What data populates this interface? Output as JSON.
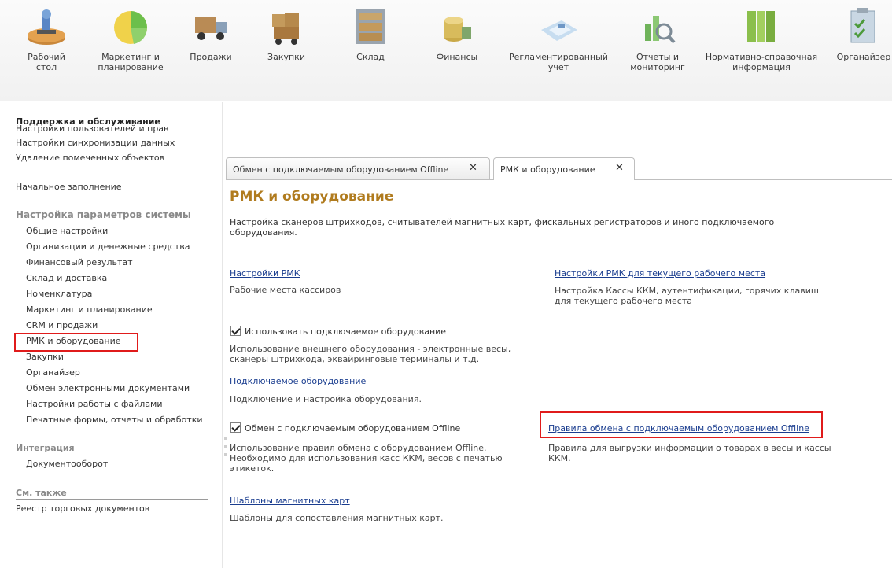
{
  "sections": [
    {
      "label": "Рабочий\nстол",
      "icon": "desktop-icon"
    },
    {
      "label": "Маркетинг и\nпланирование",
      "icon": "pie-chart-icon"
    },
    {
      "label": "Продажи",
      "icon": "truck-icon"
    },
    {
      "label": "Закупки",
      "icon": "cart-boxes-icon"
    },
    {
      "label": "Склад",
      "icon": "shelves-icon"
    },
    {
      "label": "Финансы",
      "icon": "coins-icon"
    },
    {
      "label": "Регламентированный\nучет",
      "icon": "document-stamp-icon"
    },
    {
      "label": "Отчеты и\nмониторинг",
      "icon": "report-magnifier-icon"
    },
    {
      "label": "Нормативно-справочная\nинформация",
      "icon": "binders-icon"
    },
    {
      "label": "Органайзер",
      "icon": "clipboard-icon"
    }
  ],
  "sidebar": {
    "heading": "Поддержка и обслуживание",
    "links_top": [
      "Настройки пользователей и прав",
      "Настройки синхронизации данных",
      "Удаление помеченных объектов"
    ],
    "initial_fill": "Начальное заполнение",
    "group_settings": "Настройка параметров системы",
    "settings_items": [
      "Общие настройки",
      "Организации и денежные средства",
      "Финансовый результат",
      "Склад и доставка",
      "Номенклатура",
      "Маркетинг и планирование",
      "CRM и продажи",
      "РМК и оборудование",
      "Закупки",
      "Органайзер",
      "Обмен электронными документами",
      "Настройки работы с файлами",
      "Печатные формы, отчеты и обработки"
    ],
    "group_integration": "Интеграция",
    "integration_items": [
      "Документооборот"
    ],
    "group_see_also": "См. также",
    "see_also_items": [
      "Реестр торговых документов"
    ]
  },
  "tabs": [
    {
      "label": "Обмен с подключаемым оборудованием Offline",
      "close": "✕"
    },
    {
      "label": "РМК и оборудование",
      "close": "✕"
    }
  ],
  "content": {
    "title": "РМК и оборудование",
    "description": "Настройка сканеров штрихкодов, считывателей магнитных карт, фискальных регистраторов и иного подключаемого оборудования.",
    "rmk_settings_link": "Настройки РМК",
    "rmk_settings_desc": "Рабочие места кассиров",
    "rmk_current_link": "Настройки РМК для текущего рабочего места",
    "rmk_current_desc": "Настройка Кассы ККМ, аутентификации, горячих клавиш для текущего рабочего места",
    "use_equipment_label": "Использовать подключаемое оборудование",
    "use_equipment_checked": true,
    "use_equipment_desc": "Использование внешнего оборудования - электронные весы, сканеры штрихкода, эквайринговые терминалы и т.д.",
    "equipment_link": "Подключаемое оборудование",
    "equipment_desc": "Подключение и настройка оборудования.",
    "offline_label": "Обмен с подключаемым оборудованием Offline",
    "offline_checked": true,
    "offline_desc": "Использование правил обмена с оборудованием Offline. Необходимо для использования касс ККМ, весов с печатью этикеток.",
    "offline_rules_link": "Правила обмена с подключаемым оборудованием Offline",
    "offline_rules_desc": "Правила для выгрузки информации о товарах в весы и кассы ККМ.",
    "card_templates_link": "Шаблоны магнитных карт",
    "card_templates_desc": "Шаблоны для сопоставления магнитных карт."
  },
  "colors": {
    "title": "#b07b1e",
    "link": "#1a3d8f",
    "highlight": "#e01b1b"
  }
}
